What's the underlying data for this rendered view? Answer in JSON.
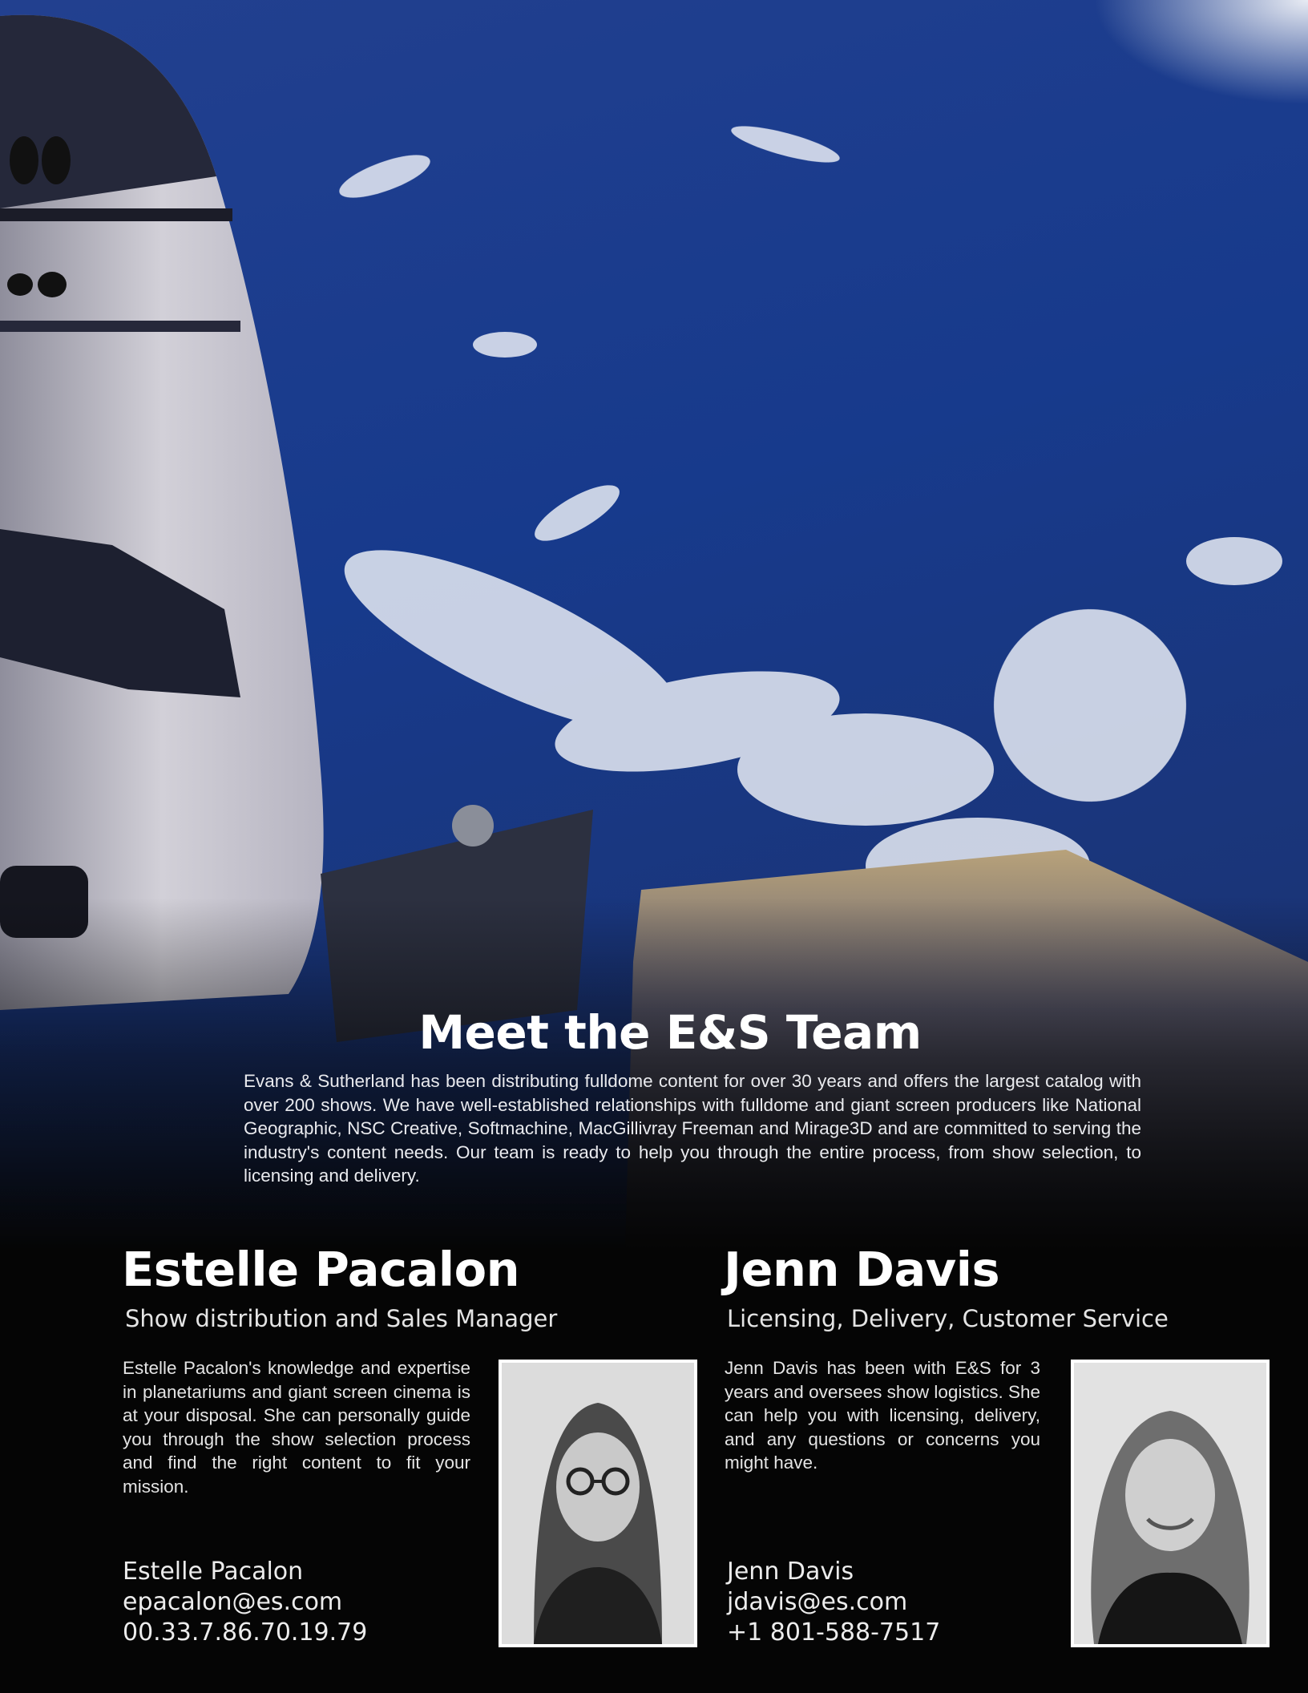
{
  "headline": "Meet the E&S Team",
  "intro": "Evans & Sutherland has been distributing fulldome content for over 30 years and offers the largest catalog with over 200 shows. We have well-established relationships with fulldome and giant screen producers like National Geographic, NSC Creative, Softmachine, MacGillivray Freeman and Mirage3D and are committed to serving the industry's content needs. Our team is ready to help you through the entire process, from show selection, to licensing and delivery.",
  "team": [
    {
      "name": "Estelle Pacalon",
      "role": "Show distribution and Sales Manager",
      "bio": "Estelle Pacalon's knowledge and expertise in planetariums and giant screen cinema is at your disposal. She can personally guide you through the show selection process and find the right content to fit your mission.",
      "contact": {
        "name": "Estelle Pacalon",
        "email": "epacalon@es.com",
        "phone": "00.33.7.86.70.19.79"
      }
    },
    {
      "name": "Jenn Davis",
      "role": "Licensing, Delivery, Customer Service",
      "bio": "Jenn Davis has been with E&S for 3 years and oversees show logistics. She can help you with licensing, delivery, and any questions or concerns you might have.",
      "contact": {
        "name": "Jenn Davis",
        "email": "jdavis@es.com",
        "phone": "+1 801-588-7517"
      }
    }
  ],
  "colors": {
    "background": "#050505",
    "ocean": "#1c3c92",
    "text": "#ffffff",
    "photo_border": "#ffffff"
  }
}
